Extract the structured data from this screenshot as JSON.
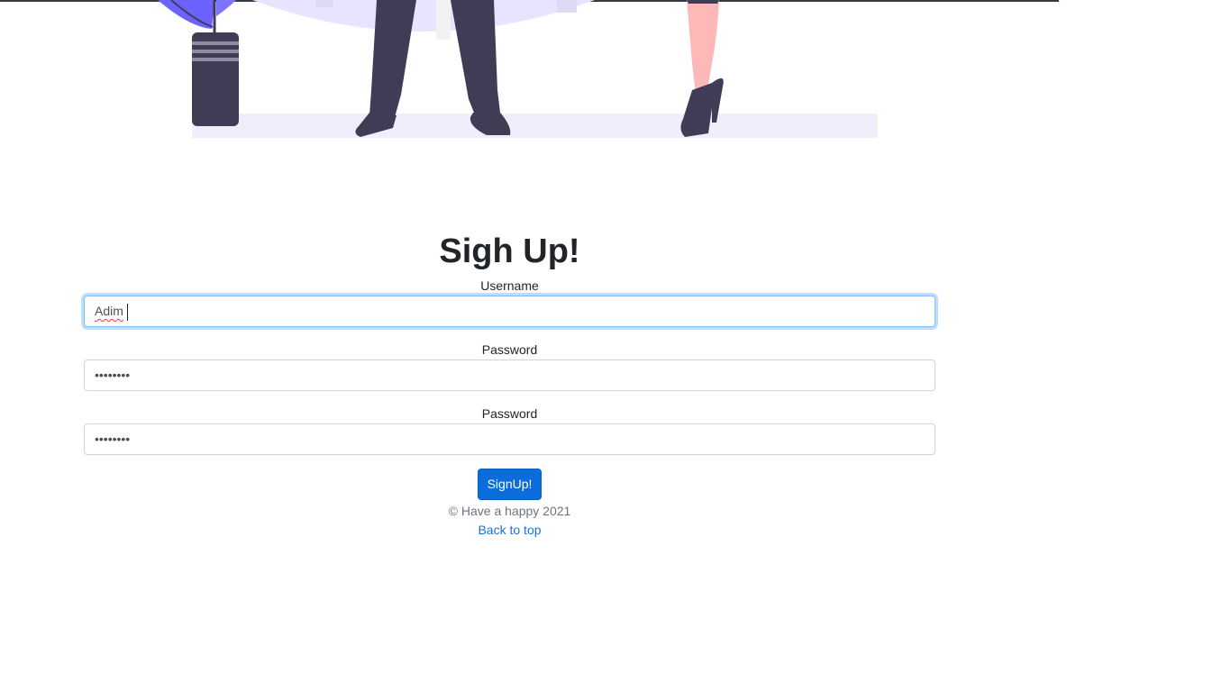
{
  "form": {
    "title": "Sigh Up!",
    "username_label": "Username",
    "username_value": "Adim",
    "password_label": "Password",
    "password_value": "••••••••",
    "confirm_label": "Password",
    "confirm_value": "••••••••",
    "submit_label": "SignUp!"
  },
  "footer": {
    "copyright": "© Have a happy 2021",
    "back_to_top": "Back to top"
  },
  "colors": {
    "primary": "#0b6ddb",
    "illustration_accent": "#6c63ff",
    "illustration_dark": "#3f3d56",
    "skin": "#ffb8b8"
  }
}
